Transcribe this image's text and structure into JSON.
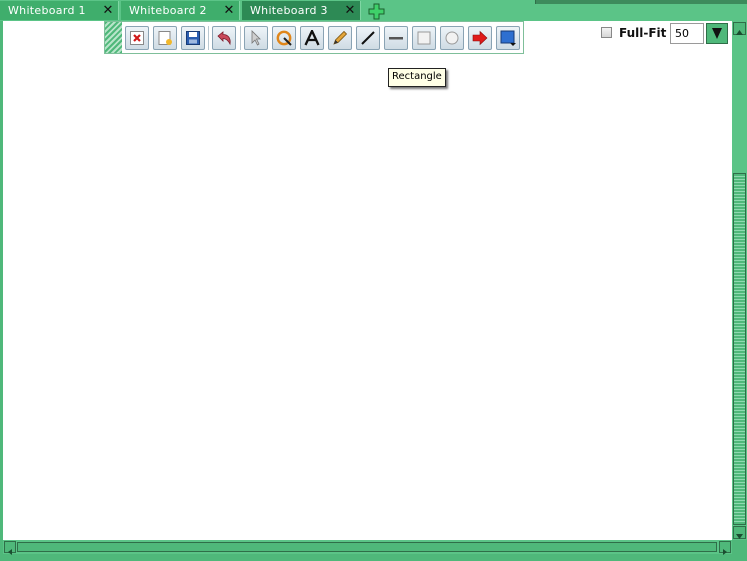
{
  "tabs": [
    {
      "label": "Whiteboard 1",
      "close": "✕"
    },
    {
      "label": "Whiteboard 2",
      "close": "✕"
    },
    {
      "label": "Whiteboard 3",
      "close": "✕"
    }
  ],
  "active_tab_index": 2,
  "toolbar": {
    "tools": [
      {
        "name": "clear",
        "icon": "clear-x-icon"
      },
      {
        "name": "new",
        "icon": "new-document-icon"
      },
      {
        "name": "save",
        "icon": "save-disk-icon"
      },
      {
        "name": "undo",
        "icon": "undo-arrow-icon"
      },
      {
        "name": "select",
        "icon": "pointer-arrow-icon"
      },
      {
        "name": "clipart",
        "icon": "clipart-icon"
      },
      {
        "name": "text",
        "icon": "text-a-icon"
      },
      {
        "name": "pencil",
        "icon": "pencil-icon"
      },
      {
        "name": "line",
        "icon": "line-icon"
      },
      {
        "name": "underline",
        "icon": "horizontal-bar-icon"
      },
      {
        "name": "rectangle",
        "icon": "rectangle-icon"
      },
      {
        "name": "ellipse",
        "icon": "ellipse-icon"
      },
      {
        "name": "arrow",
        "icon": "red-arrow-icon"
      },
      {
        "name": "color",
        "icon": "color-picker-icon"
      }
    ]
  },
  "tooltip": {
    "text": "Rectangle"
  },
  "fullfit": {
    "label": "Full-Fit",
    "checked": false
  },
  "zoom": {
    "value": "50"
  },
  "colors": {
    "accent": "#4fb87a",
    "tab_active": "#2d8a55",
    "arrow_red": "#e01b1b"
  }
}
